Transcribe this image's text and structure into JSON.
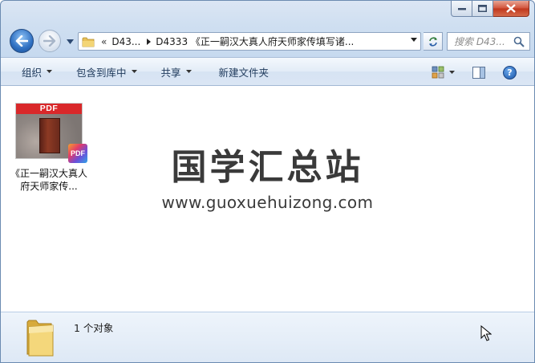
{
  "window": {
    "caption_buttons": [
      "minimize",
      "maximize",
      "close"
    ]
  },
  "nav": {
    "back_icon": "back-arrow-icon",
    "forward_icon": "forward-arrow-icon",
    "address": {
      "overflow": "«",
      "segment1": "D43...",
      "segment2": "D4333 《正一嗣汉大真人府天师家传填写诸..."
    },
    "search_placeholder": "搜索 D43..."
  },
  "toolbar": {
    "organize": "组织",
    "include_library": "包含到库中",
    "share": "共享",
    "new_folder": "新建文件夹"
  },
  "files": [
    {
      "name": "《正一嗣汉大真人府天师家传...",
      "type_label": "PDF",
      "badge": "PDF"
    }
  ],
  "watermark": {
    "title": "国学汇总站",
    "url": "www.guoxuehuizong.com"
  },
  "details": {
    "count": "1 个对象"
  },
  "colors": {
    "accent": "#1e395b",
    "pdf_red": "#d9282a",
    "close_red": "#c0361c"
  }
}
